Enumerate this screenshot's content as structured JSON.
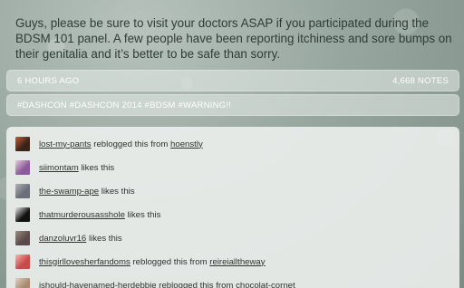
{
  "post": {
    "body_text": "Guys, please be sure to visit your doctors ASAP if you participated during the BDSM 101 panel. A few people have been reporting itchiness and sore bumps on their genitalia and it’s better to be safe than sorry."
  },
  "meta": {
    "time_ago": "6 HOURS AGO",
    "notes_count": "4,668 NOTES"
  },
  "tags": {
    "text": "#DASHCON #DASHCON 2014 #BDSM #WARNING!!"
  },
  "notes": [
    {
      "user": "lost-my-pants",
      "action": " reblogged this from ",
      "source": "hoenstly",
      "avatar_color": "#3a2418",
      "avatar_accent": "#c85a3a"
    },
    {
      "user": "siimontam",
      "action": " likes this",
      "source": "",
      "avatar_color": "#8a5a9a",
      "avatar_accent": "#e7c8d8"
    },
    {
      "user": "the-swamp-ape",
      "action": " likes this",
      "source": "",
      "avatar_color": "#6a6e78",
      "avatar_accent": "#b4b0b8"
    },
    {
      "user": "thatmurderousasshole",
      "action": " likes this",
      "source": "",
      "avatar_color": "#111111",
      "avatar_accent": "#e8e8e8"
    },
    {
      "user": "danzoluvr16",
      "action": " likes this",
      "source": "",
      "avatar_color": "#5a4a4a",
      "avatar_accent": "#9a8a80"
    },
    {
      "user": "thisgirllovesherfandoms",
      "action": " reblogged this from ",
      "source": "reireialltheway",
      "avatar_color": "#c84a4a",
      "avatar_accent": "#f0b8b0"
    },
    {
      "user": "ishould-havenamed-herdebbie",
      "action": " reblogged this from ",
      "source": "chocolat-cornet",
      "avatar_color": "#a88a70",
      "avatar_accent": "#e0d0c0"
    }
  ]
}
